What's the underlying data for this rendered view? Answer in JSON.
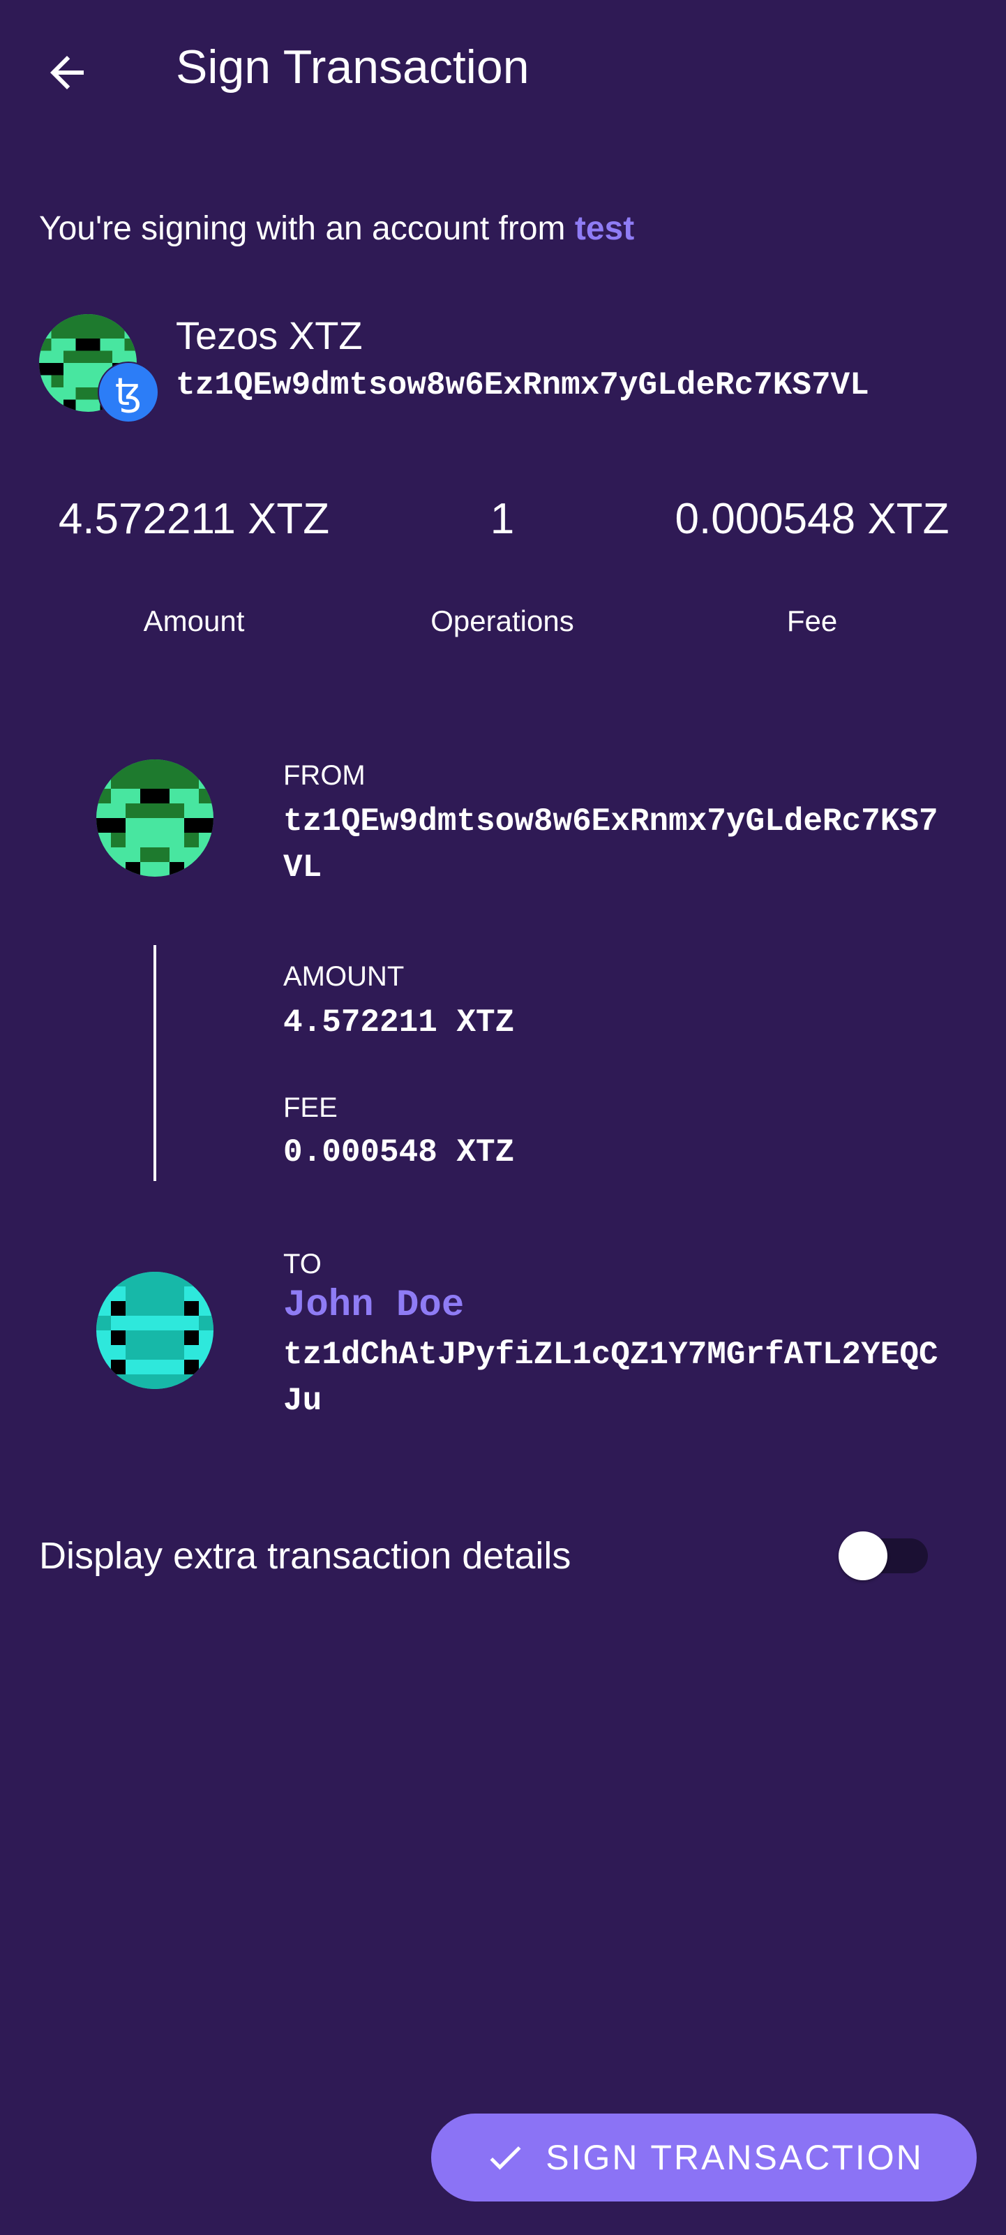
{
  "colors": {
    "background": "#2f1a55",
    "accent": "#8f7cf5",
    "button": "#8b73f5",
    "tezos_badge": "#2c7df7"
  },
  "header": {
    "back_icon": "arrow-left-icon",
    "title": "Sign Transaction"
  },
  "signing": {
    "prefix": "You're signing with an account from",
    "account_name": "test"
  },
  "account": {
    "coin_name": "Tezos XTZ",
    "address": "tz1QEw9dmtsow8w6ExRnmx7yGLdeRc7KS7VL",
    "badge_icon": "tezos-icon",
    "badge_glyph": "ꜩ"
  },
  "summary": {
    "amount_value": "4.572211 XTZ",
    "amount_label": "Amount",
    "operations_value": "1",
    "operations_label": "Operations",
    "fee_value": "0.000548 XTZ",
    "fee_label": "Fee"
  },
  "details": {
    "from_label": "FROM",
    "from_address": "tz1QEw9dmtsow8w6ExRnmx7yGLdeRc7KS7VL",
    "amount_label": "AMOUNT",
    "amount_value": "4.572211 XTZ",
    "fee_label": "FEE",
    "fee_value": "0.000548 XTZ",
    "to_label": "TO",
    "to_name": "John Doe",
    "to_address": "tz1dChAtJPyfiZL1cQZ1Y7MGrfATL2YEQCJu"
  },
  "extra_details": {
    "label": "Display extra transaction details",
    "enabled": false
  },
  "sign_button": {
    "icon": "check-icon",
    "label": "SIGN TRANSACTION"
  }
}
